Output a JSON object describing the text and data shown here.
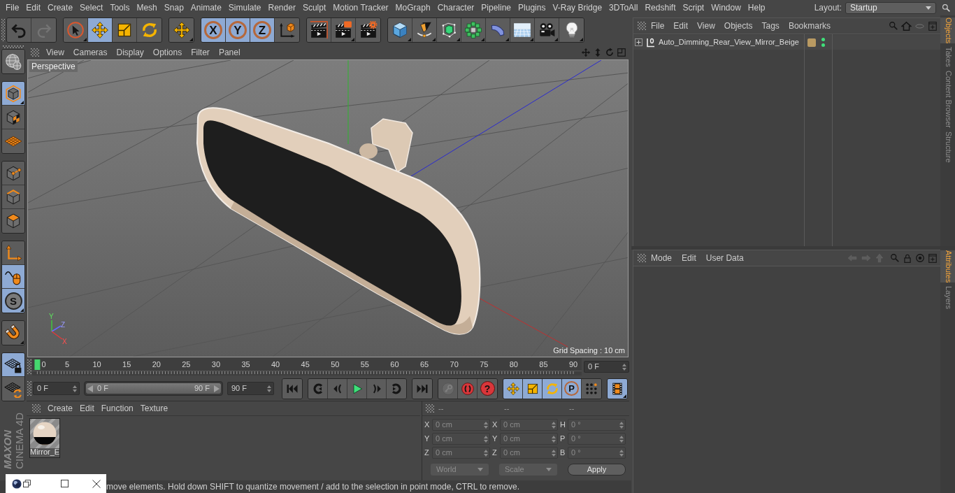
{
  "menu_bar": {
    "items": [
      "File",
      "Edit",
      "Create",
      "Select",
      "Tools",
      "Mesh",
      "Snap",
      "Animate",
      "Simulate",
      "Render",
      "Sculpt",
      "Motion Tracker",
      "MoGraph",
      "Character",
      "Pipeline",
      "Plugins",
      "V-Ray Bridge",
      "3DToAll",
      "Redshift",
      "Script",
      "Window",
      "Help"
    ],
    "layout_label": "Layout:",
    "layout_value": "Startup"
  },
  "toolbar": [
    [
      {
        "kind": "undo",
        "selected": false,
        "disabled": false,
        "caret": false
      },
      {
        "kind": "redo",
        "selected": false,
        "disabled": true,
        "caret": false
      }
    ],
    [
      {
        "kind": "cursor",
        "selected": false,
        "disabled": false,
        "caret": true
      },
      {
        "kind": "move",
        "selected": true,
        "disabled": false,
        "caret": false
      },
      {
        "kind": "scale",
        "selected": false,
        "disabled": false,
        "caret": false
      },
      {
        "kind": "rotate",
        "selected": false,
        "disabled": false,
        "caret": false
      }
    ],
    [
      {
        "kind": "move",
        "selected": false,
        "disabled": false,
        "caret": true
      }
    ],
    [
      {
        "kind": "axis",
        "label": "X",
        "selected": true,
        "disabled": false,
        "caret": false
      },
      {
        "kind": "axis",
        "label": "Y",
        "selected": true,
        "disabled": false,
        "caret": false
      },
      {
        "kind": "axis",
        "label": "Z",
        "selected": true,
        "disabled": false,
        "caret": false
      },
      {
        "kind": "coords",
        "selected": false,
        "disabled": false,
        "caret": false
      }
    ],
    [
      {
        "kind": "render",
        "selected": false,
        "disabled": false,
        "caret": false
      },
      {
        "kind": "render_window",
        "selected": false,
        "disabled": false,
        "caret": true
      },
      {
        "kind": "render_settings",
        "selected": false,
        "disabled": false,
        "caret": false
      }
    ],
    [
      {
        "kind": "cube",
        "selected": false,
        "disabled": false,
        "caret": true
      },
      {
        "kind": "pen",
        "selected": false,
        "disabled": false,
        "caret": true
      },
      {
        "kind": "subdiv",
        "selected": false,
        "disabled": false,
        "caret": true
      },
      {
        "kind": "cloner",
        "selected": false,
        "disabled": false,
        "caret": true
      },
      {
        "kind": "bend",
        "selected": false,
        "disabled": false,
        "caret": true
      },
      {
        "kind": "floor",
        "selected": false,
        "disabled": false,
        "caret": true
      },
      {
        "kind": "camera",
        "selected": false,
        "disabled": false,
        "caret": true
      },
      {
        "kind": "light",
        "selected": false,
        "disabled": false,
        "caret": true
      }
    ]
  ],
  "left_toolbar": [
    [
      {
        "kind": "globe",
        "selected": false,
        "caret": false
      }
    ],
    [
      {
        "kind": "model",
        "selected": true,
        "caret": true
      },
      {
        "kind": "texture",
        "selected": false,
        "caret": false
      },
      {
        "kind": "workplane",
        "selected": false,
        "caret": false
      }
    ],
    [
      {
        "kind": "points",
        "selected": false,
        "caret": false
      },
      {
        "kind": "edges",
        "selected": false,
        "caret": false
      },
      {
        "kind": "polygons",
        "selected": false,
        "caret": false
      }
    ],
    [
      {
        "kind": "axis_mode",
        "selected": false,
        "caret": false
      },
      {
        "kind": "tweak",
        "selected": true,
        "caret": false
      },
      {
        "kind": "snap",
        "label": "S",
        "selected": true,
        "caret": true
      }
    ],
    [
      {
        "kind": "magnet",
        "selected": false,
        "caret": true
      }
    ],
    [
      {
        "kind": "workplane_lock",
        "selected": true,
        "caret": false
      },
      {
        "kind": "workplane_align",
        "selected": false,
        "caret": false
      }
    ]
  ],
  "logo": [
    "MAXON",
    "CINEMA 4D"
  ],
  "viewport": {
    "menu": [
      "View",
      "Cameras",
      "Display",
      "Options",
      "Filter",
      "Panel"
    ],
    "camera": "Perspective",
    "grid_spacing": "Grid Spacing : 10 cm",
    "gizmo_axes": [
      "Y",
      "Z",
      "X"
    ]
  },
  "timeline": {
    "labels": [
      "0",
      "5",
      "10",
      "15",
      "20",
      "25",
      "30",
      "35",
      "40",
      "45",
      "50",
      "55",
      "60",
      "65",
      "70",
      "75",
      "80",
      "85",
      "90"
    ],
    "level": 0,
    "current_frame": "0 F"
  },
  "transport": {
    "start": "0 F",
    "range": {
      "start": "0 F",
      "end": "90 F",
      "level": 1
    },
    "end": "90 F",
    "buttons": [
      [
        {
          "kind": "first",
          "selected": false,
          "disabled": false,
          "caret": false
        }
      ],
      [
        {
          "kind": "prevkey",
          "selected": false,
          "disabled": false,
          "caret": false
        },
        {
          "kind": "prevframe",
          "selected": false,
          "disabled": false,
          "caret": false
        },
        {
          "kind": "play",
          "selected": false,
          "disabled": false,
          "caret": false
        },
        {
          "kind": "nextframe",
          "selected": false,
          "disabled": false,
          "caret": false
        },
        {
          "kind": "nextkey",
          "selected": false,
          "disabled": false,
          "caret": false
        }
      ],
      [
        {
          "kind": "last",
          "selected": false,
          "disabled": false,
          "caret": false
        }
      ],
      [
        {
          "kind": "key",
          "selected": false,
          "disabled": true,
          "caret": false
        },
        {
          "kind": "record",
          "selected": false,
          "disabled": false,
          "caret": false
        },
        {
          "kind": "autokey",
          "label": "?",
          "selected": false,
          "disabled": false,
          "caret": false
        }
      ],
      [
        {
          "kind": "move",
          "selected": true,
          "disabled": false,
          "caret": false
        },
        {
          "kind": "scale",
          "selected": true,
          "disabled": false,
          "caret": false
        },
        {
          "kind": "rotate",
          "selected": true,
          "disabled": false,
          "caret": false
        },
        {
          "kind": "param",
          "label": "P",
          "selected": true,
          "disabled": false,
          "caret": false
        },
        {
          "kind": "dots",
          "selected": false,
          "disabled": false,
          "caret": false
        }
      ],
      [
        {
          "kind": "film",
          "selected": true,
          "disabled": false,
          "caret": true
        }
      ]
    ]
  },
  "materials": {
    "menu": [
      "Create",
      "Edit",
      "Function",
      "Texture"
    ],
    "items": [
      {
        "name": "Mirror_E"
      }
    ]
  },
  "coordinates": {
    "headers": [
      "--",
      "--",
      "--"
    ],
    "columns": [
      [
        {
          "axis": "X",
          "value": "0 cm"
        },
        {
          "axis": "Y",
          "value": "0 cm"
        },
        {
          "axis": "Z",
          "value": "0 cm"
        }
      ],
      [
        {
          "axis": "X",
          "value": "0 cm"
        },
        {
          "axis": "Y",
          "value": "0 cm"
        },
        {
          "axis": "Z",
          "value": "0 cm"
        }
      ],
      [
        {
          "axis": "H",
          "value": "0 °"
        },
        {
          "axis": "P",
          "value": "0 °"
        },
        {
          "axis": "B",
          "value": "0 °"
        }
      ]
    ],
    "mode": "World",
    "transform": "Scale",
    "apply": "Apply"
  },
  "status_bar": {
    "text": "move elements. Hold down SHIFT to quantize movement / add to the selection in point mode, CTRL to remove."
  },
  "objects": {
    "menu": [
      "File",
      "Edit",
      "View",
      "Objects",
      "Tags",
      "Bookmarks"
    ],
    "items": [
      {
        "name": "Auto_Dimming_Rear_View_Mirror_Beige",
        "expanded": false,
        "tags": [
          {
            "kind": "material"
          }
        ],
        "editor_visible": true,
        "render_visible": true
      }
    ]
  },
  "side_tabs_top": [
    {
      "label": "Objects",
      "selected": true
    },
    {
      "label": "Takes",
      "selected": false
    },
    {
      "label": "Content Browser",
      "selected": false
    },
    {
      "label": "Structure",
      "selected": false
    }
  ],
  "attributes": {
    "menu": [
      "Mode",
      "Edit",
      "User Data"
    ]
  },
  "side_tabs_bottom": [
    {
      "label": "Attributes",
      "selected": true
    },
    {
      "label": "Layers",
      "selected": false
    }
  ]
}
